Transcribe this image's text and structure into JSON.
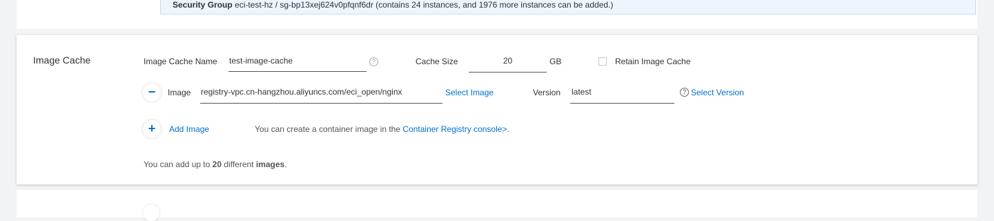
{
  "security_group": {
    "label": "Security Group",
    "value": "eci-test-hz / sg-bp13xej624v0pfqnf6dr (contains 24 instances, and 1976 more instances can be added.)"
  },
  "image_cache": {
    "section_title": "Image Cache",
    "name_label": "Image Cache Name",
    "name_value": "test-image-cache",
    "cache_size_label": "Cache Size",
    "cache_size_value": "20",
    "cache_size_unit": "GB",
    "retain_label": "Retain Image Cache",
    "retain_checked": false,
    "image_label": "Image",
    "image_value": "registry-vpc.cn-hangzhou.aliyuncs.com/eci_open/nginx",
    "select_image": "Select Image",
    "version_label": "Version",
    "version_value": "latest",
    "select_version": "Select Version",
    "add_image": "Add Image",
    "registry_hint": "You can create a container image in the",
    "registry_link": "Container Registry console>",
    "registry_hint_end": ".",
    "limit_prefix": "You can add up to",
    "limit_count": "20",
    "limit_middle": "different",
    "limit_emphasis": "images",
    "limit_end": "."
  },
  "icons": {
    "help": "question-circle-icon",
    "remove": "minus-icon",
    "add": "plus-icon"
  },
  "colors": {
    "link": "#0070cc",
    "notice_background": "#edf5fd",
    "page_background": "#f2f3f5"
  }
}
